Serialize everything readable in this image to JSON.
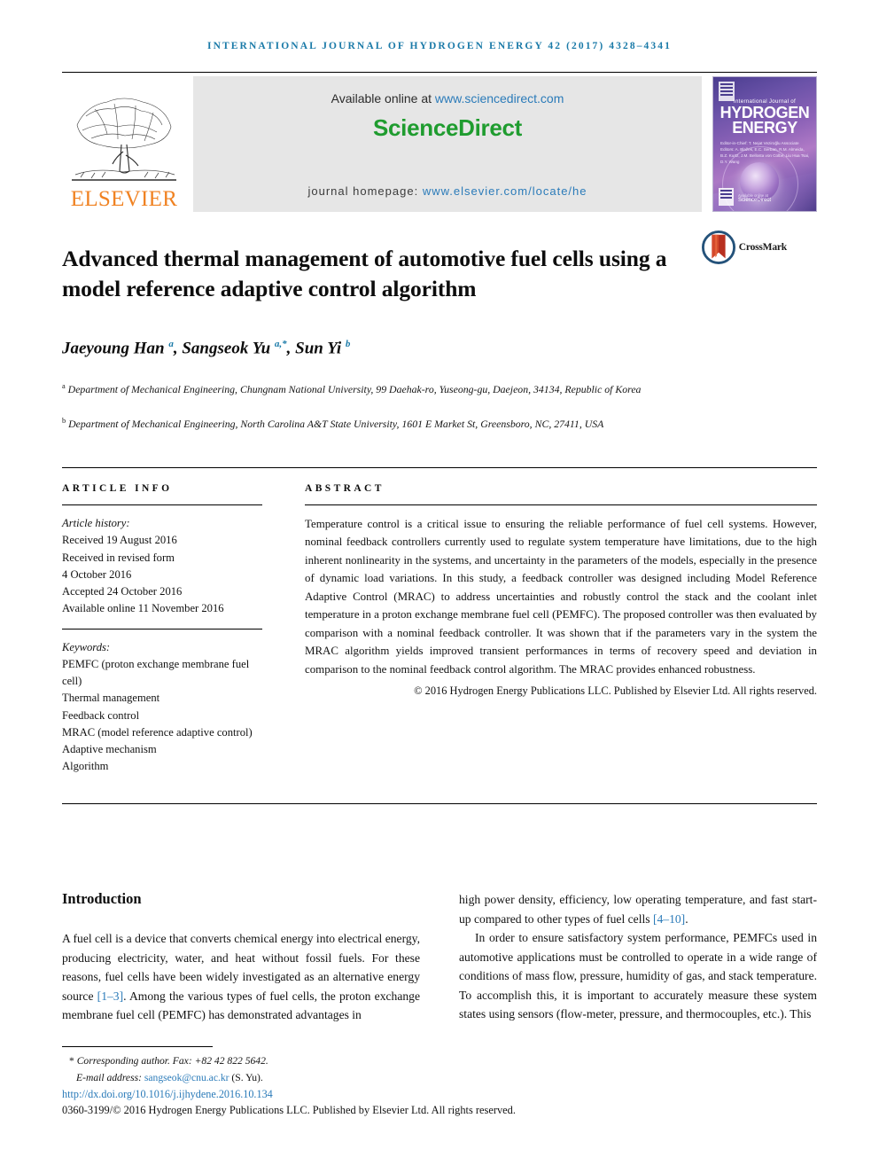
{
  "running_head": "International Journal of Hydrogen Energy 42 (2017) 4328–4341",
  "masthead": {
    "publisher_name": "ELSEVIER",
    "available_prefix": "Available online at ",
    "available_link": "www.sciencedirect.com",
    "sciencedirect_logo": "ScienceDirect",
    "homepage_prefix": "journal homepage: ",
    "homepage_link": "www.elsevier.com/locate/he",
    "cover": {
      "line1": "International Journal of",
      "line2": "HYDROGEN",
      "line3": "ENERGY",
      "editors": "Editor-in-Chief: T. Nejat Veziroğlu    Associate Editors: A. Blažek, E.C. Serban, R.M. Almeida, B.Z. Kurtz, J.M. Bellosta von Colbe, Liu Hua Tsai, D.Y. Wang",
      "sd_tag": "ScienceDirect",
      "sd_sub": "Available online at"
    }
  },
  "article": {
    "title": "Advanced thermal management of automotive fuel cells using a model reference adaptive control algorithm",
    "crossmark_label": "CrossMark",
    "authors_html": "Jaeyoung Han <sup>a</sup>, Sangseok Yu <sup>a,*</sup>, Sun Yi <sup>b</sup>",
    "affiliation_a": "Department of Mechanical Engineering, Chungnam National University, 99 Daehak-ro, Yuseong-gu, Daejeon, 34134, Republic of Korea",
    "affiliation_b": "Department of Mechanical Engineering, North Carolina A&T State University, 1601 E Market St, Greensboro, NC, 27411, USA",
    "affiliation_a_marker": "a",
    "affiliation_b_marker": "b"
  },
  "info": {
    "heading": "ARTICLE INFO",
    "history_label": "Article history:",
    "history": [
      "Received 19 August 2016",
      "Received in revised form",
      "4 October 2016",
      "Accepted 24 October 2016",
      "Available online 11 November 2016"
    ],
    "keywords_label": "Keywords:",
    "keywords": [
      "PEMFC (proton exchange membrane fuel cell)",
      "Thermal management",
      "Feedback control",
      "MRAC (model reference adaptive control)",
      "Adaptive mechanism",
      "Algorithm"
    ]
  },
  "abstract": {
    "heading": "ABSTRACT",
    "text": "Temperature control is a critical issue to ensuring the reliable performance of fuel cell systems. However, nominal feedback controllers currently used to regulate system temperature have limitations, due to the high inherent nonlinearity in the systems, and uncertainty in the parameters of the models, especially in the presence of dynamic load variations. In this study, a feedback controller was designed including Model Reference Adaptive Control (MRAC) to address uncertainties and robustly control the stack and the coolant inlet temperature in a proton exchange membrane fuel cell (PEMFC). The proposed controller was then evaluated by comparison with a nominal feedback controller. It was shown that if the parameters vary in the system the MRAC algorithm yields improved transient performances in terms of recovery speed and deviation in comparison to the nominal feedback control algorithm. The MRAC provides enhanced robustness.",
    "copyright": "© 2016 Hydrogen Energy Publications LLC. Published by Elsevier Ltd. All rights reserved."
  },
  "introduction": {
    "heading": "Introduction",
    "left_paragraph_1_a": "A fuel cell is a device that converts chemical energy into electrical energy, producing electricity, water, and heat without fossil fuels. For these reasons, fuel cells have been widely investigated as an alternative energy source ",
    "left_ref_1": "[1–3]",
    "left_paragraph_1_b": ". Among the various types of fuel cells, the proton exchange membrane fuel cell (PEMFC) has demonstrated advantages in",
    "right_paragraph_1_a": "high power density, efficiency, low operating temperature, and fast start-up compared to other types of fuel cells ",
    "right_ref_1": "[4–10]",
    "right_paragraph_1_b": ".",
    "right_paragraph_2": "In order to ensure satisfactory system performance, PEMFCs used in automotive applications must be controlled to operate in a wide range of conditions of mass flow, pressure, humidity of gas, and stack temperature. To accomplish this, it is important to accurately measure these system states using sensors (flow-meter, pressure, and thermocouples, etc.). This"
  },
  "footer": {
    "corresponding_marker": "*",
    "corresponding": " Corresponding author. Fax: +82 42 822 5642.",
    "email_label": "E-mail address: ",
    "email": "sangseok@cnu.ac.kr",
    "email_suffix": " (S. Yu).",
    "doi": "http://dx.doi.org/10.1016/j.ijhydene.2016.10.134",
    "issn_line": "0360-3199/© 2016 Hydrogen Energy Publications LLC. Published by Elsevier Ltd. All rights reserved."
  },
  "colors": {
    "journal_header": "#1a7aa8",
    "link_blue": "#2b7bb9",
    "elsevier_orange": "#f08222",
    "sciencedirect_green": "#1f9c2f"
  }
}
